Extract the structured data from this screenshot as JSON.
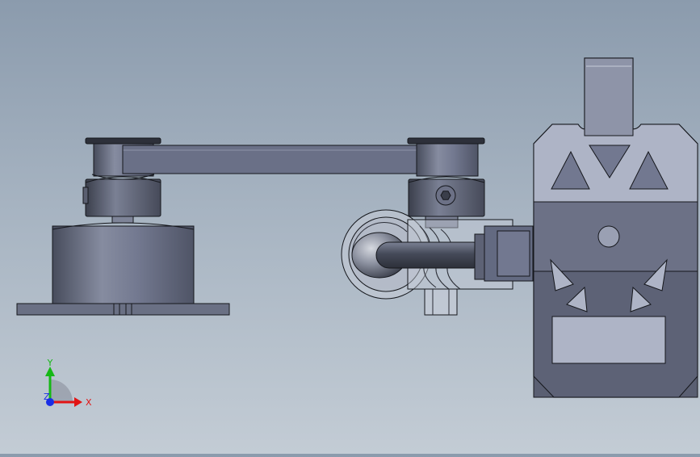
{
  "viewport": {
    "background_top": "#8b9bad",
    "background_bottom": "#c3ccd5"
  },
  "model": {
    "parts": [
      "base-mount",
      "shoulder-hub",
      "link-arm",
      "elbow-hub",
      "rod-end-joint",
      "threaded-rod",
      "end-plate"
    ],
    "colors": {
      "body": "#646a7f",
      "body_light": "#8e94a8",
      "edge": "#15171c",
      "plate": "#6f7489",
      "plate_light": "#aeb4c6",
      "rod": "#4a4f5f"
    }
  },
  "triad": {
    "x_label": "X",
    "y_label": "Y",
    "z_label": "Z",
    "x_color": "#e21414",
    "y_color": "#16b816",
    "z_color": "#1a2ee6"
  }
}
